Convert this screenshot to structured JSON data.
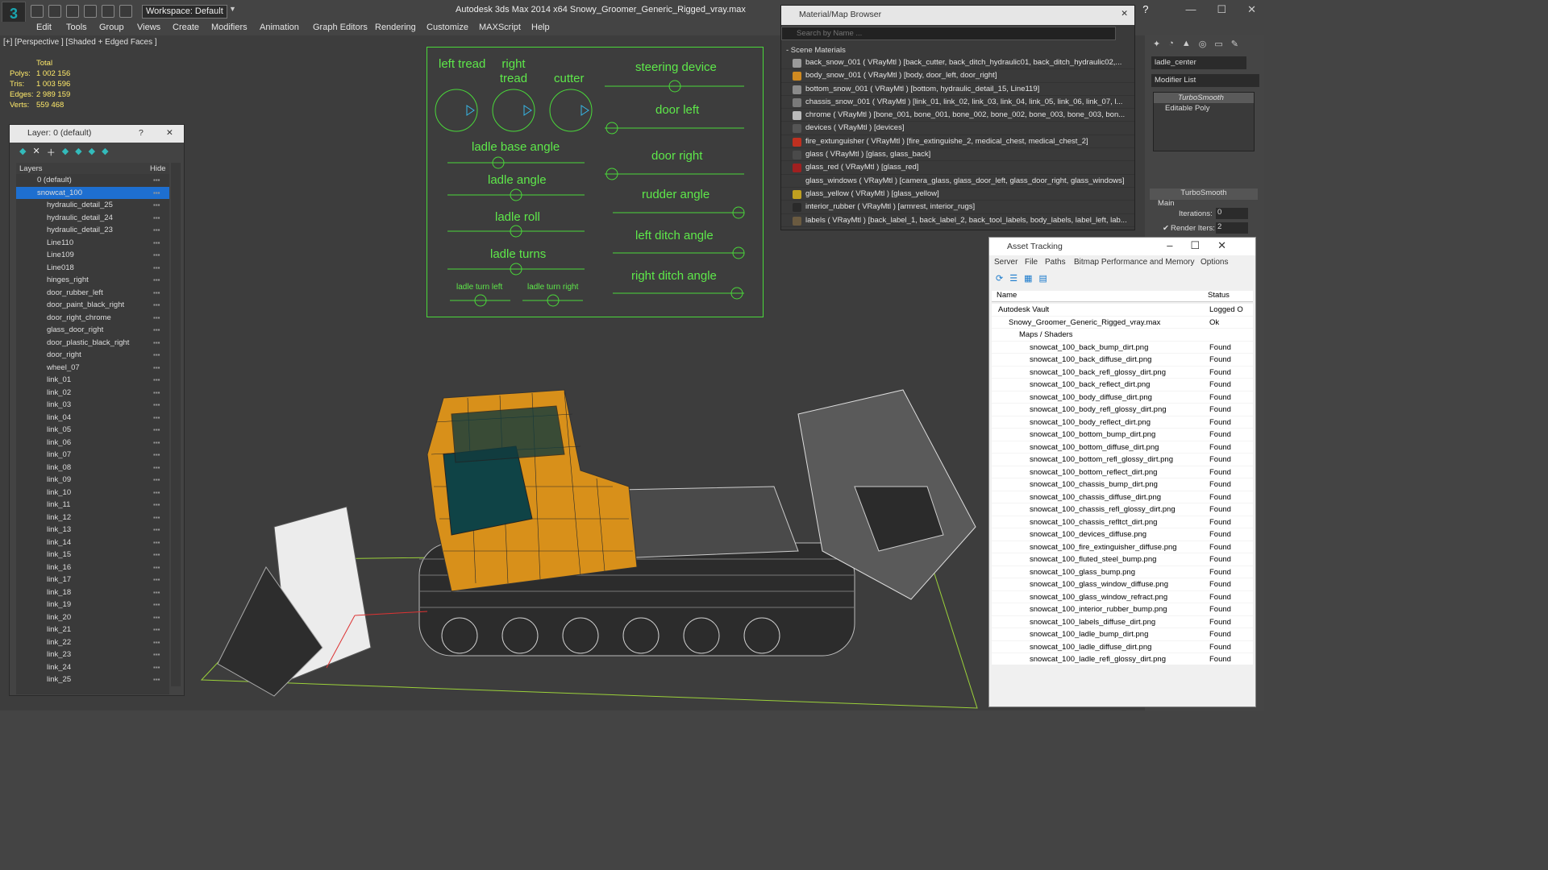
{
  "app": {
    "title": "Autodesk 3ds Max  2014 x64      Snowy_Groomer_Generic_Rigged_vray.max",
    "workspace": "Workspace: Default",
    "menu": [
      "Edit",
      "Tools",
      "Group",
      "Views",
      "Create",
      "Modifiers",
      "Animation",
      "Graph Editors",
      "Rendering",
      "Customize",
      "MAXScript",
      "Help"
    ]
  },
  "viewport": {
    "label": "[+] [Perspective ] [Shaded + Edged Faces ]",
    "stats": {
      "header": "Total",
      "rows": [
        {
          "label": "Polys:",
          "value": "1 002 156"
        },
        {
          "label": "Tris:",
          "value": "1 003 596"
        },
        {
          "label": "Edges:",
          "value": "2 989 159"
        },
        {
          "label": "Verts:",
          "value": "559 468"
        }
      ]
    }
  },
  "layer_panel": {
    "title": "Layer: 0 (default)",
    "help": "?",
    "close": "✕",
    "col_layers": "Layers",
    "col_hide": "Hide",
    "rows": [
      "0 (default)",
      "snowcat_100",
      "hydraulic_detail_25",
      "hydraulic_detail_24",
      "hydraulic_detail_23",
      "Line110",
      "Line109",
      "Line018",
      "hinges_right",
      "door_rubber_left",
      "door_paint_black_right",
      "door_right_chrome",
      "glass_door_right",
      "door_plastic_black_right",
      "door_right",
      "wheel_07",
      "link_01",
      "link_02",
      "link_03",
      "link_04",
      "link_05",
      "link_06",
      "link_07",
      "link_08",
      "link_09",
      "link_10",
      "link_11",
      "link_12",
      "link_13",
      "link_14",
      "link_15",
      "link_16",
      "link_17",
      "link_18",
      "link_19",
      "link_20",
      "link_21",
      "link_22",
      "link_23",
      "link_24",
      "link_25"
    ]
  },
  "hud": {
    "labels": {
      "left_tread": "left tread",
      "right_tread": "right tread",
      "cutter": "cutter",
      "steering": "steering device",
      "door_left": "door left",
      "door_right": "door right",
      "ladle_base": "ladle base angle",
      "ladle_angle": "ladle angle",
      "ladle_roll": "ladle roll",
      "ladle_turns": "ladle turns",
      "ladle_turn_left": "ladle turn left",
      "ladle_turn_right": "ladle turn right",
      "rudder": "rudder angle",
      "left_ditch": "left ditch angle",
      "right_ditch": "right ditch angle"
    }
  },
  "material_browser": {
    "title": "Material/Map Browser",
    "search_placeholder": "Search by Name ...",
    "section": "- Scene Materials",
    "rows": [
      {
        "text": "back_snow_001  ( VRayMtl ) [back_cutter, back_ditch_hydraulic01, back_ditch_hydraulic02,...",
        "color": "#9a9a9a"
      },
      {
        "text": "body_snow_001  ( VRayMtl ) [body, door_left, door_right]",
        "color": "#d08a20"
      },
      {
        "text": "bottom_snow_001  ( VRayMtl ) [bottom, hydraulic_detail_15, Line119]",
        "color": "#8a8a8a"
      },
      {
        "text": "chassis_snow_001  ( VRayMtl ) [link_01, link_02, link_03, link_04, link_05, link_06, link_07, l...",
        "color": "#7a7a7a"
      },
      {
        "text": "chrome  ( VRayMtl ) [bone_001, bone_001, bone_002, bone_002, bone_003, bone_003, bon...",
        "color": "#bbbbbb"
      },
      {
        "text": "devices  ( VRayMtl ) [devices]",
        "color": "#555555"
      },
      {
        "text": "fire_extunguisher  ( VRayMtl ) [fire_extinguishe_2, medical_chest, medical_chest_2]",
        "color": "#c03020"
      },
      {
        "text": "glass  ( VRayMtl ) [glass, glass_back]",
        "color": "#4a4a4a"
      },
      {
        "text": "glass_red  ( VRayMtl ) [glass_red]",
        "color": "#a02020"
      },
      {
        "text": "glass_windows  ( VRayMtl ) [camera_glass, glass_door_left, glass_door_right, glass_windows]",
        "color": "#3a3a3a"
      },
      {
        "text": "glass_yellow  ( VRayMtl ) [glass_yellow]",
        "color": "#c0a020"
      },
      {
        "text": "interior_rubber  ( VRayMtl ) [armrest, interior_rugs]",
        "color": "#2a2a2a"
      },
      {
        "text": "labels  ( VRayMtl ) [back_label_1, back_label_2, back_tool_labels, body_labels, label_left, lab...",
        "color": "#6a5a40"
      }
    ]
  },
  "command_panel": {
    "object_name": "ladle_center",
    "modifier_list": "Modifier List",
    "stack": [
      "TurboSmooth",
      "Editable Poly"
    ],
    "rollout": "TurboSmooth",
    "main": "Main",
    "iterations_label": "Iterations:",
    "iterations_value": "0",
    "render_iters_label": "Render Iters:",
    "render_iters_value": "2"
  },
  "asset_tracking": {
    "title": "Asset Tracking",
    "menu": [
      "Server",
      "File",
      "Paths",
      "Bitmap Performance and Memory",
      "Options"
    ],
    "col_name": "Name",
    "col_status": "Status",
    "rows": [
      {
        "name": "Autodesk Vault",
        "status": "Logged O",
        "indent": 1
      },
      {
        "name": "Snowy_Groomer_Generic_Rigged_vray.max",
        "status": "Ok",
        "indent": 2
      },
      {
        "name": "Maps / Shaders",
        "status": "",
        "indent": 3
      },
      {
        "name": "snowcat_100_back_bump_dirt.png",
        "status": "Found",
        "indent": 4
      },
      {
        "name": "snowcat_100_back_diffuse_dirt.png",
        "status": "Found",
        "indent": 4
      },
      {
        "name": "snowcat_100_back_refl_glossy_dirt.png",
        "status": "Found",
        "indent": 4
      },
      {
        "name": "snowcat_100_back_reflect_dirt.png",
        "status": "Found",
        "indent": 4
      },
      {
        "name": "snowcat_100_body_diffuse_dirt.png",
        "status": "Found",
        "indent": 4
      },
      {
        "name": "snowcat_100_body_refl_glossy_dirt.png",
        "status": "Found",
        "indent": 4
      },
      {
        "name": "snowcat_100_body_reflect_dirt.png",
        "status": "Found",
        "indent": 4
      },
      {
        "name": "snowcat_100_bottom_bump_dirt.png",
        "status": "Found",
        "indent": 4
      },
      {
        "name": "snowcat_100_bottom_diffuse_dirt.png",
        "status": "Found",
        "indent": 4
      },
      {
        "name": "snowcat_100_bottom_refl_glossy_dirt.png",
        "status": "Found",
        "indent": 4
      },
      {
        "name": "snowcat_100_bottom_reflect_dirt.png",
        "status": "Found",
        "indent": 4
      },
      {
        "name": "snowcat_100_chassis_bump_dirt.png",
        "status": "Found",
        "indent": 4
      },
      {
        "name": "snowcat_100_chassis_diffuse_dirt.png",
        "status": "Found",
        "indent": 4
      },
      {
        "name": "snowcat_100_chassis_refl_glossy_dirt.png",
        "status": "Found",
        "indent": 4
      },
      {
        "name": "snowcat_100_chassis_refltct_dirt.png",
        "status": "Found",
        "indent": 4
      },
      {
        "name": "snowcat_100_devices_diffuse.png",
        "status": "Found",
        "indent": 4
      },
      {
        "name": "snowcat_100_fire_extinguisher_diffuse.png",
        "status": "Found",
        "indent": 4
      },
      {
        "name": "snowcat_100_fluted_steel_bump.png",
        "status": "Found",
        "indent": 4
      },
      {
        "name": "snowcat_100_glass_bump.png",
        "status": "Found",
        "indent": 4
      },
      {
        "name": "snowcat_100_glass_window_diffuse.png",
        "status": "Found",
        "indent": 4
      },
      {
        "name": "snowcat_100_glass_window_refract.png",
        "status": "Found",
        "indent": 4
      },
      {
        "name": "snowcat_100_interior_rubber_bump.png",
        "status": "Found",
        "indent": 4
      },
      {
        "name": "snowcat_100_labels_diffuse_dirt.png",
        "status": "Found",
        "indent": 4
      },
      {
        "name": "snowcat_100_ladle_bump_dirt.png",
        "status": "Found",
        "indent": 4
      },
      {
        "name": "snowcat_100_ladle_diffuse_dirt.png",
        "status": "Found",
        "indent": 4
      },
      {
        "name": "snowcat_100_ladle_refl_glossy_dirt.png",
        "status": "Found",
        "indent": 4
      }
    ]
  }
}
